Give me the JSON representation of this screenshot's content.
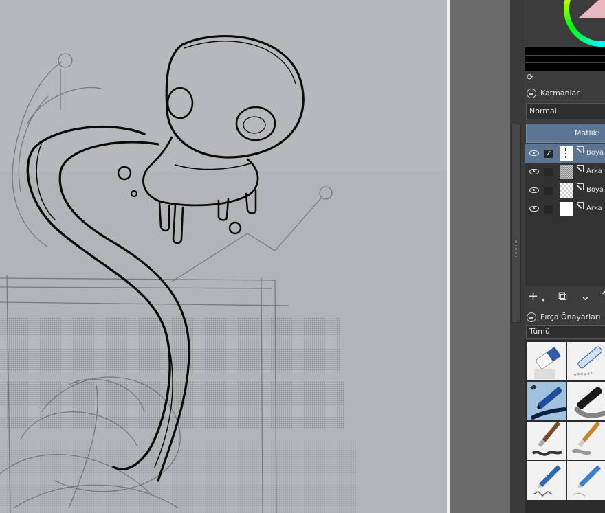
{
  "layers_panel": {
    "title": "Katmanlar",
    "blend_mode": "Normal",
    "opacity_label": "Matlık:",
    "layers": [
      {
        "name": "Boya",
        "visible": true,
        "checked": true,
        "active": true,
        "thumb": "paint"
      },
      {
        "name": "Arka",
        "visible": true,
        "checked": false,
        "active": false,
        "thumb": "noise"
      },
      {
        "name": "Boya",
        "visible": true,
        "checked": false,
        "active": false,
        "thumb": "checker"
      },
      {
        "name": "Arka",
        "visible": true,
        "checked": false,
        "active": false,
        "thumb": "white"
      }
    ],
    "toolbar": {
      "add": "+",
      "duplicate": "⧉",
      "move_down": "⌄"
    }
  },
  "brush_presets_panel": {
    "title": "Fırça Önayarları",
    "filter": "Tümü",
    "presets": [
      {
        "name": "eraser",
        "selected": false
      },
      {
        "name": "blue-marker",
        "selected": false
      },
      {
        "name": "ink-pen",
        "selected": true
      },
      {
        "name": "black-marker",
        "selected": false
      },
      {
        "name": "brush-dark",
        "selected": false
      },
      {
        "name": "brush-light",
        "selected": false
      },
      {
        "name": "pencil-dark",
        "selected": false
      },
      {
        "name": "pencil-light",
        "selected": false
      }
    ]
  },
  "colors": {
    "accent": "#5b7593",
    "canvas": "#b1b2b6",
    "panel": "#3c3c3c"
  }
}
